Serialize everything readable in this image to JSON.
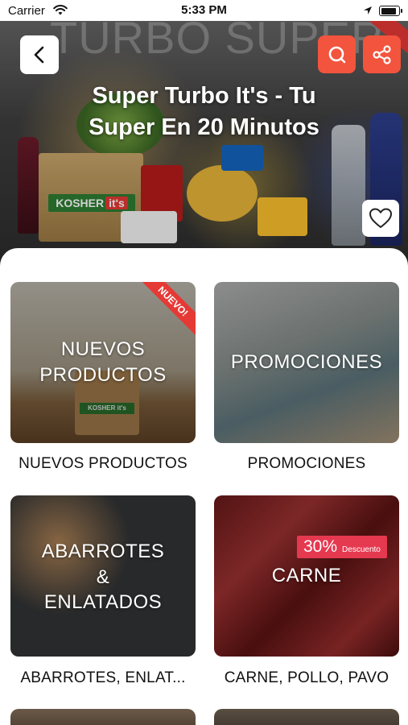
{
  "status_bar": {
    "carrier": "Carrier",
    "time": "5:33 PM"
  },
  "hero": {
    "watermark": "TURBO SUPER",
    "title": "Super Turbo It's - Tu Super En 20 Minutos",
    "bag_brand": "KOSHER",
    "bag_brand_suffix": "it's"
  },
  "colors": {
    "accent": "#f2543d",
    "badge": "#e53950"
  },
  "categories": [
    {
      "card_label_line1": "NUEVOS",
      "card_label_line2": "PRODUCTOS",
      "caption": "NUEVOS PRODUCTOS",
      "ribbon": "NUEVO!",
      "bag_tag": "KOSHER it's"
    },
    {
      "card_label_line1": "PROMOCIONES",
      "caption": "PROMOCIONES"
    },
    {
      "card_label_line1": "ABARROTES",
      "card_label_line2": "&",
      "card_label_line3": "ENLATADOS",
      "caption": "ABARROTES, ENLAT..."
    },
    {
      "card_label_line1": "CARNE",
      "caption": "CARNE, POLLO, PAVO",
      "badge_pct": "30%",
      "badge_text": "Descuento"
    }
  ]
}
